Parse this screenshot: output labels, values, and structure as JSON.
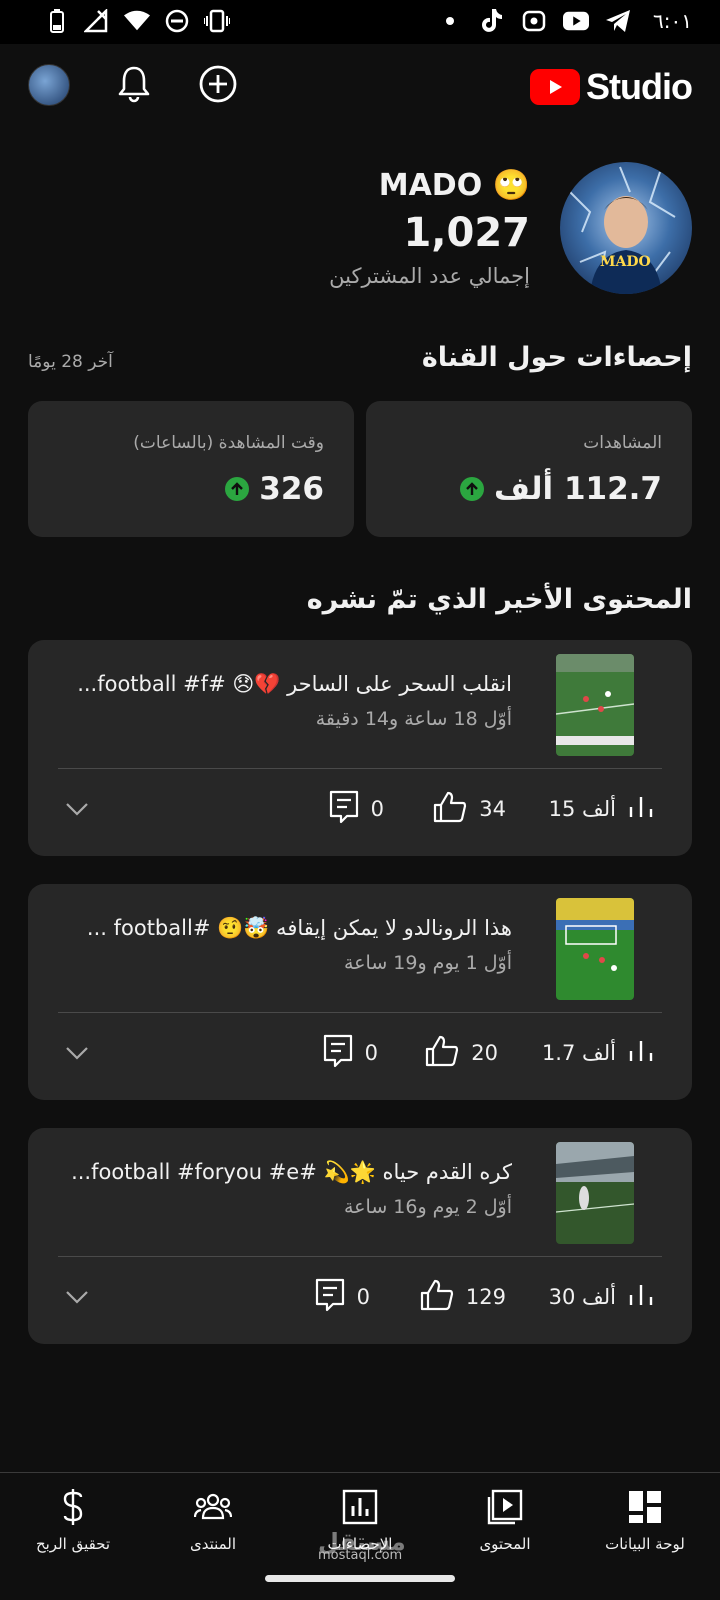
{
  "status_bar": {
    "time": "٦:٠١",
    "icons": [
      "battery-icon",
      "no-signal-icon",
      "wifi-icon",
      "do-not-disturb-icon",
      "vibrate-icon",
      "dot-icon",
      "tiktok-icon",
      "screen-record-icon",
      "youtube-icon",
      "telegram-icon"
    ]
  },
  "header": {
    "logo_text": "Studio",
    "icons": [
      "avatar",
      "bell-icon",
      "add-circle-icon",
      "youtube-logo-icon"
    ]
  },
  "channel": {
    "name": "MADO 🙄",
    "subscribers": "1,027",
    "subscribers_label": "إجمالي عدد المشتركين",
    "avatar_text": "MADO"
  },
  "analytics": {
    "title": "إحصاءات حول القناة",
    "period": "آخر 28 يومًا",
    "cards": [
      {
        "label": "المشاهدات",
        "value": "112.7 ألف"
      },
      {
        "label": "وقت المشاهدة (بالساعات)",
        "value": "326"
      }
    ]
  },
  "recent": {
    "title": "المحتوى الأخير الذي تمّ نشره",
    "videos": [
      {
        "title": "انقلب السحر على الساحر 💔😞 #football #f...",
        "age": "أوّل 18 ساعة و14 دقيقة",
        "views": "15 ألف",
        "likes": "34",
        "comments": "0"
      },
      {
        "title": "هذا الرونالدو لا يمكن إيقافه 🤯🤨 #football ...",
        "age": "أوّل 1 يوم و19 ساعة",
        "views": "1.7 ألف",
        "likes": "20",
        "comments": "0"
      },
      {
        "title": "كره القدم حياه 🌟💫 #football #foryou #e...",
        "age": "أوّل 2 يوم و16 ساعة",
        "views": "30 ألف",
        "likes": "129",
        "comments": "0"
      }
    ]
  },
  "bottom_nav": [
    {
      "label": "لوحة البيانات",
      "icon": "dashboard-icon"
    },
    {
      "label": "المحتوى",
      "icon": "content-icon"
    },
    {
      "label": "الإحصاءات",
      "icon": "analytics-icon"
    },
    {
      "label": "المنتدى",
      "icon": "community-icon"
    },
    {
      "label": "تحقيق الربح",
      "icon": "earn-icon"
    }
  ],
  "watermark": {
    "text": "mostaql.com",
    "logo": "مستقل"
  }
}
